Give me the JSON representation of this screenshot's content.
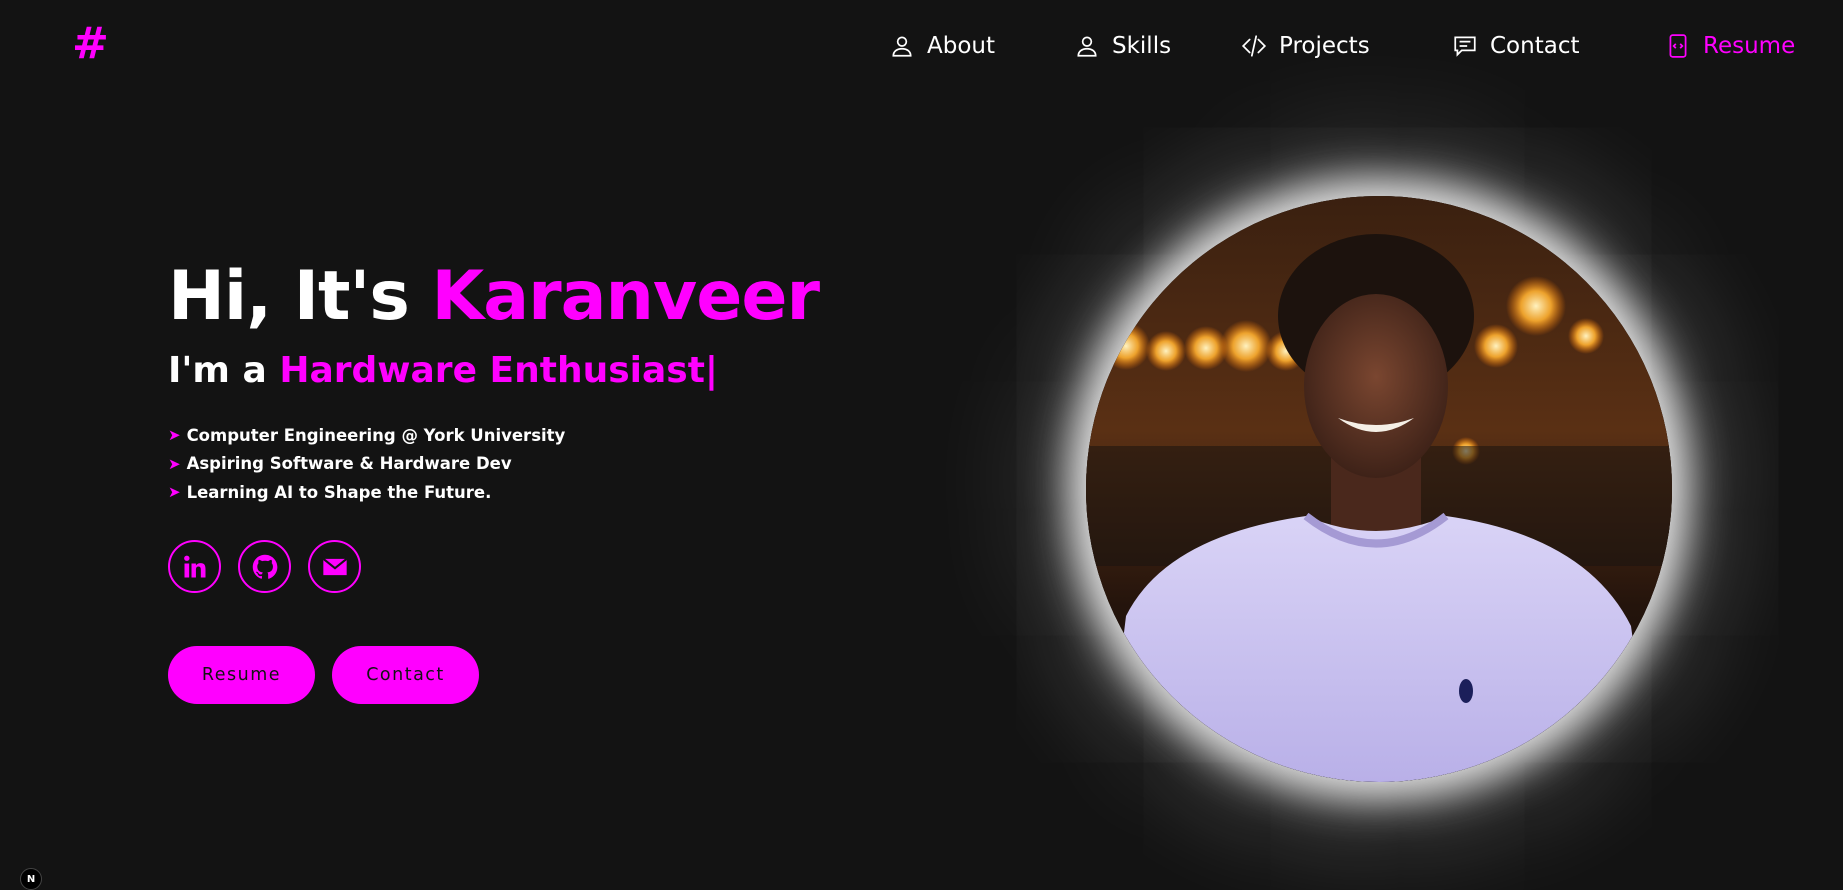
{
  "logo": {
    "text": "#"
  },
  "nav": {
    "items": [
      {
        "label": "About",
        "icon": "user-icon"
      },
      {
        "label": "Skills",
        "icon": "user-icon"
      },
      {
        "label": "Projects",
        "icon": "code-icon"
      },
      {
        "label": "Contact",
        "icon": "message-icon"
      },
      {
        "label": "Resume",
        "icon": "file-code-icon"
      }
    ]
  },
  "hero": {
    "greeting": "Hi, It's",
    "name": "Karanveer",
    "sub_prefix": "I'm a",
    "role": "Hardware Enthusiast|",
    "bullet_marker": "➤",
    "bullets": [
      "Computer Engineering @ York University",
      "Aspiring Software & Hardware Dev",
      "Learning AI to Shape the Future."
    ]
  },
  "socials": [
    {
      "name": "linkedin",
      "icon": "linkedin-icon"
    },
    {
      "name": "github",
      "icon": "github-icon"
    },
    {
      "name": "email",
      "icon": "mail-icon"
    }
  ],
  "buttons": {
    "resume": "Resume",
    "contact": "Contact"
  },
  "badge": {
    "text": "N"
  },
  "colors": {
    "background": "#131313",
    "accent": "#ff00ff",
    "text": "#ffffff"
  }
}
